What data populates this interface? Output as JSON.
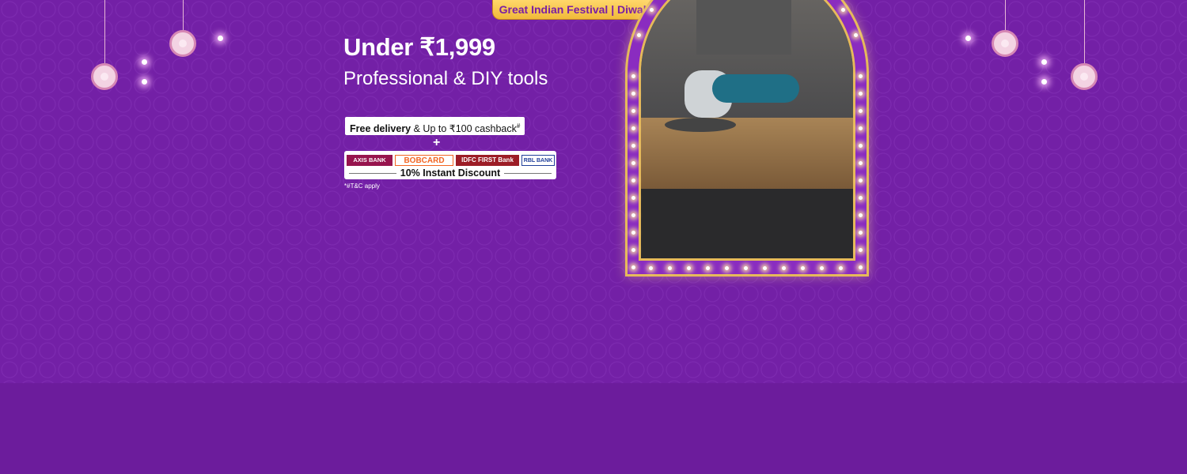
{
  "banner": {
    "ribbon_label": "Great Indian Festival | Diwali Special",
    "headline": "Under ₹1,999",
    "subheadline": "Professional & DIY tools",
    "delivery_bold": "Free delivery",
    "delivery_rest": " & Up to ₹100 cashback",
    "delivery_sup": "#",
    "plus_sign": "+",
    "banks": [
      "AXIS BANK",
      "BOBCARD",
      "IDFC FIRST Bank",
      "RBL BANK"
    ],
    "discount_label": "10% Instant Discount",
    "tnc": "*#T&C apply"
  },
  "colors": {
    "background": "#7320a6",
    "ribbon": "#f0b93a",
    "ribbon_text": "#7a1fa3",
    "arch_border": "#e6b95a"
  },
  "product_image": {
    "icon": "angle-grinder-photo"
  }
}
